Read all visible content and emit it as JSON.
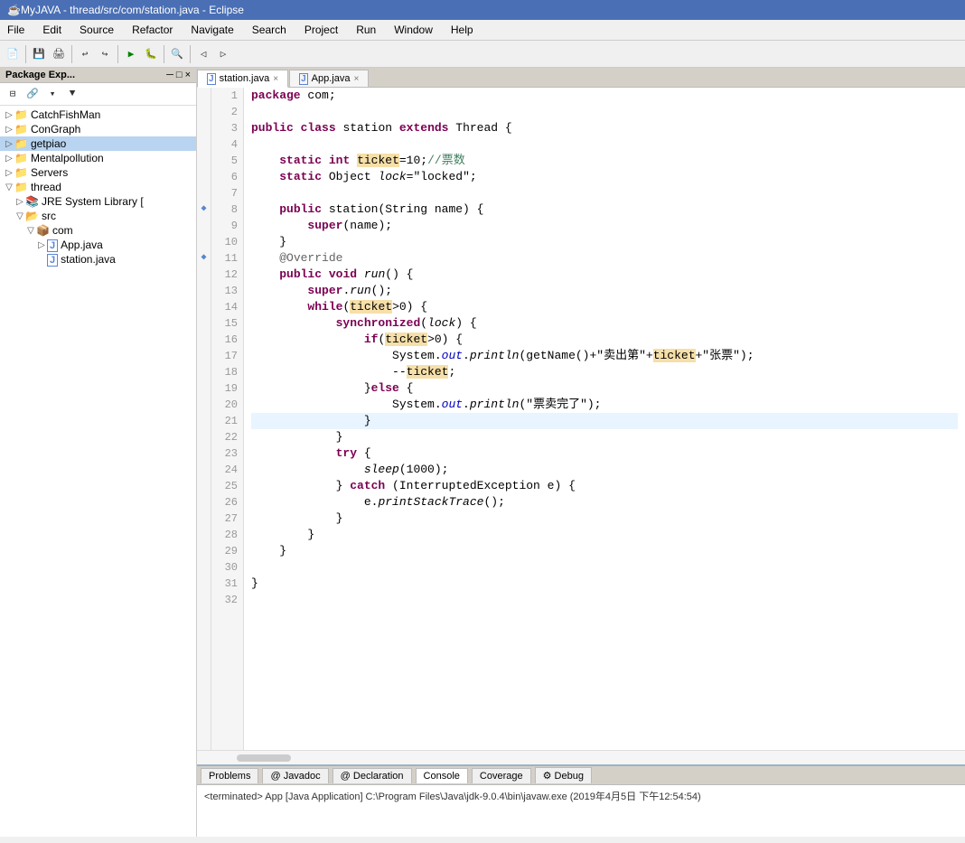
{
  "title_bar": {
    "text": "MyJAVA - thread/src/com/station.java - Eclipse",
    "icon": "☕"
  },
  "menu": {
    "items": [
      "File",
      "Edit",
      "Source",
      "Refactor",
      "Navigate",
      "Search",
      "Project",
      "Run",
      "Window",
      "Help"
    ]
  },
  "package_explorer": {
    "title": "Package Exp...",
    "close_label": "×",
    "minimize_label": "─",
    "maximize_label": "□",
    "tree": [
      {
        "label": "CatchFishMan",
        "indent": "indent1",
        "icon": "📁",
        "arrow": "▷",
        "type": "project"
      },
      {
        "label": "ConGraph",
        "indent": "indent1",
        "icon": "📁",
        "arrow": "▷",
        "type": "project"
      },
      {
        "label": "getpiao",
        "indent": "indent1",
        "icon": "📁",
        "arrow": "▷",
        "type": "project",
        "selected": true
      },
      {
        "label": "Mentalpollution",
        "indent": "indent1",
        "icon": "📁",
        "arrow": "▷",
        "type": "project"
      },
      {
        "label": "Servers",
        "indent": "indent1",
        "icon": "📁",
        "arrow": "▷",
        "type": "project"
      },
      {
        "label": "thread",
        "indent": "indent1",
        "icon": "📁",
        "arrow": "▽",
        "type": "project"
      },
      {
        "label": "JRE System Library [",
        "indent": "indent2",
        "icon": "📚",
        "arrow": "▷",
        "type": "library"
      },
      {
        "label": "src",
        "indent": "indent2",
        "icon": "📂",
        "arrow": "▽",
        "type": "folder"
      },
      {
        "label": "com",
        "indent": "indent3",
        "icon": "📦",
        "arrow": "▽",
        "type": "package"
      },
      {
        "label": "App.java",
        "indent": "indent4",
        "icon": "J",
        "arrow": "▷",
        "type": "java"
      },
      {
        "label": "station.java",
        "indent": "indent4",
        "icon": "J",
        "arrow": " ",
        "type": "java"
      }
    ]
  },
  "editor": {
    "tabs": [
      {
        "label": "station.java",
        "active": true,
        "icon": "J"
      },
      {
        "label": "App.java",
        "active": false,
        "icon": "J"
      }
    ]
  },
  "code": {
    "lines": [
      {
        "num": 1,
        "marker": "",
        "html": "<span class='kw'>package</span> com;"
      },
      {
        "num": 2,
        "marker": "",
        "html": ""
      },
      {
        "num": 3,
        "marker": "",
        "html": "<span class='kw'>public</span> <span class='kw'>class</span> station <span class='kw'>extends</span> Thread {"
      },
      {
        "num": 4,
        "marker": "",
        "html": ""
      },
      {
        "num": 5,
        "marker": "",
        "html": "    <span class='kw'>static</span> <span class='kw'>int</span> <span class='var-highlight'>ticket</span>=10;<span class='comment'>//票数</span>"
      },
      {
        "num": 6,
        "marker": "",
        "html": "    <span class='kw'>static</span> Object <span class='italic'>lock</span>=\"locked\";"
      },
      {
        "num": 7,
        "marker": "",
        "html": ""
      },
      {
        "num": 8,
        "marker": "◆",
        "html": "    <span class='kw'>public</span> station(String name) {"
      },
      {
        "num": 9,
        "marker": "",
        "html": "        <span class='kw'>super</span>(name);"
      },
      {
        "num": 10,
        "marker": "",
        "html": "    }"
      },
      {
        "num": 11,
        "marker": "◆",
        "html": "    <span class='annotation'>@Override</span>"
      },
      {
        "num": 12,
        "marker": "",
        "html": "    <span class='kw'>public</span> <span class='kw'>void</span> <span class='method'>run</span>() {"
      },
      {
        "num": 13,
        "marker": "",
        "html": "        <span class='kw'>super</span>.<span class='method'>run</span>();"
      },
      {
        "num": 14,
        "marker": "",
        "html": "        <span class='kw'>while</span>(<span class='var-highlight'>ticket</span>&gt;0) {"
      },
      {
        "num": 15,
        "marker": "",
        "html": "            <span class='kw'>synchronized</span>(<span class='italic'>lock</span>) {"
      },
      {
        "num": 16,
        "marker": "",
        "html": "                <span class='kw'>if</span>(<span class='var-highlight'>ticket</span>&gt;0) {"
      },
      {
        "num": 17,
        "marker": "",
        "html": "                    System.<span class='out-field'>out</span>.<span class='method'>println</span>(getName()+\"卖出第\"+<span class='var-highlight'>ticket</span>+\"张票\");"
      },
      {
        "num": 18,
        "marker": "",
        "html": "                    --<span class='var-highlight'>ticket</span>;"
      },
      {
        "num": 19,
        "marker": "",
        "html": "                }<span class='kw'>else</span> {"
      },
      {
        "num": 20,
        "marker": "",
        "html": "                    System.<span class='out-field'>out</span>.<span class='method'>println</span>(\"票卖完了\");"
      },
      {
        "num": 21,
        "marker": "",
        "html": "                }",
        "current": true
      },
      {
        "num": 22,
        "marker": "",
        "html": "            }"
      },
      {
        "num": 23,
        "marker": "",
        "html": "            <span class='kw'>try</span> {"
      },
      {
        "num": 24,
        "marker": "",
        "html": "                <span class='italic'>sleep</span>(1000);"
      },
      {
        "num": 25,
        "marker": "",
        "html": "            } <span class='kw'>catch</span> (InterruptedException e) {"
      },
      {
        "num": 26,
        "marker": "",
        "html": "                e.<span class='method'>printStackTrace</span>();"
      },
      {
        "num": 27,
        "marker": "",
        "html": "            }"
      },
      {
        "num": 28,
        "marker": "",
        "html": "        }"
      },
      {
        "num": 29,
        "marker": "",
        "html": "    }"
      },
      {
        "num": 30,
        "marker": "",
        "html": ""
      },
      {
        "num": 31,
        "marker": "",
        "html": "}"
      },
      {
        "num": 32,
        "marker": "",
        "html": ""
      }
    ]
  },
  "bottom_tabs": [
    "Problems",
    "@ Javadoc",
    "@ Declaration",
    "Console",
    "Coverage",
    "⚙ Debug"
  ],
  "console": {
    "active_tab": "Console",
    "terminated_msg": "<terminated> App [Java Application] C:\\Program Files\\Java\\jdk-9.0.4\\bin\\javaw.exe (2019年4月5日 下午12:54:54)"
  }
}
